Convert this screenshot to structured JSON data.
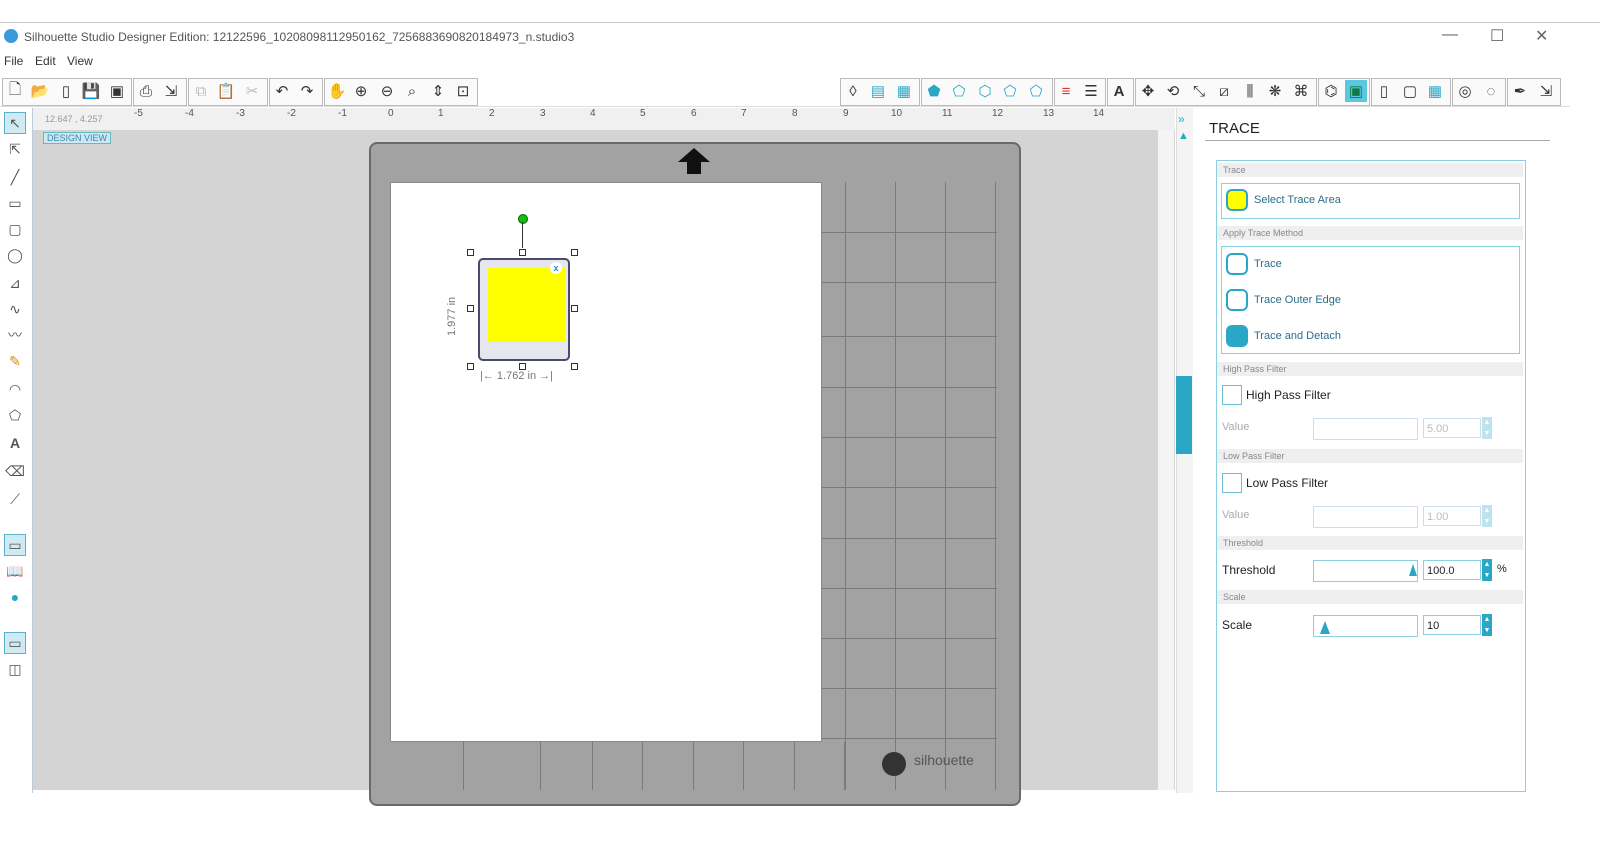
{
  "window": {
    "title": "Silhouette Studio Designer Edition: 12122596_10208098112950162_7256883690820184973_n.studio3",
    "minimize": "—",
    "maximize": "☐",
    "close": "✕"
  },
  "menu": [
    "File",
    "Edit",
    "View"
  ],
  "ruler": {
    "coords": "12.647 , 4.257",
    "ticks": [
      "-5",
      "-4",
      "-3",
      "-2",
      "-1",
      "0",
      "1",
      "2",
      "3",
      "4",
      "5",
      "6",
      "7",
      "8",
      "9",
      "10",
      "11",
      "12",
      "13",
      "14"
    ]
  },
  "canvas": {
    "design_view_label": "DESIGN VIEW",
    "brand": "silhouette",
    "object": {
      "width_label": "1.762 in",
      "height_label": "1.977 in",
      "badge": "x"
    }
  },
  "trace_panel": {
    "title": "TRACE",
    "sections": {
      "trace": "Trace",
      "apply_method": "Apply Trace Method",
      "high_pass": "High Pass Filter",
      "low_pass": "Low Pass Filter",
      "threshold": "Threshold",
      "scale": "Scale"
    },
    "select_area_label": "Select Trace Area",
    "methods": [
      "Trace",
      "Trace Outer Edge",
      "Trace and Detach"
    ],
    "high_pass": {
      "checkbox_label": "High Pass Filter",
      "value_label": "Value",
      "value": "5.00"
    },
    "low_pass": {
      "checkbox_label": "Low Pass Filter",
      "value_label": "Value",
      "value": "1.00"
    },
    "threshold": {
      "label": "Threshold",
      "value": "100.0",
      "unit": "%"
    },
    "scale": {
      "label": "Scale",
      "value": "10"
    }
  },
  "colors": {
    "accent": "#2aa7c6",
    "selection_fill": "#ffff00",
    "mat": "#a2a2a2"
  }
}
